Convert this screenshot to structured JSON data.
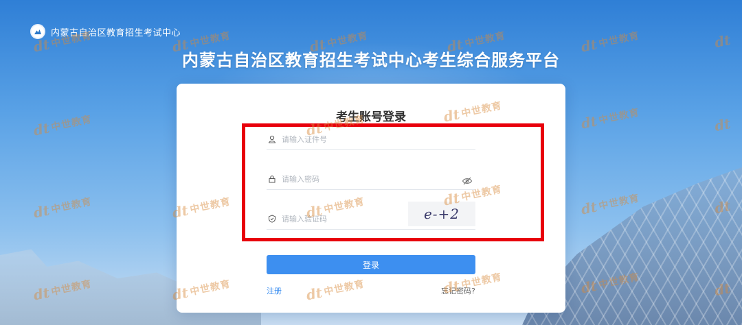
{
  "header": {
    "org_name": "内蒙古自治区教育招生考试中心",
    "platform_title": "内蒙古自治区教育招生考试中心考生综合服务平台"
  },
  "login": {
    "title": "考生账号登录",
    "id_placeholder": "请输入证件号",
    "password_placeholder": "请输入密码",
    "captcha_placeholder": "请输入验证码",
    "captcha_text": "e-+2",
    "submit_label": "登录",
    "register_label": "注册",
    "forgot_label": "忘记密码?"
  },
  "watermark": {
    "text": "中世教育",
    "mark": "dt"
  },
  "colors": {
    "accent": "#3d8ff0",
    "highlight": "#e8000b",
    "watermark": "#d98a3a"
  }
}
